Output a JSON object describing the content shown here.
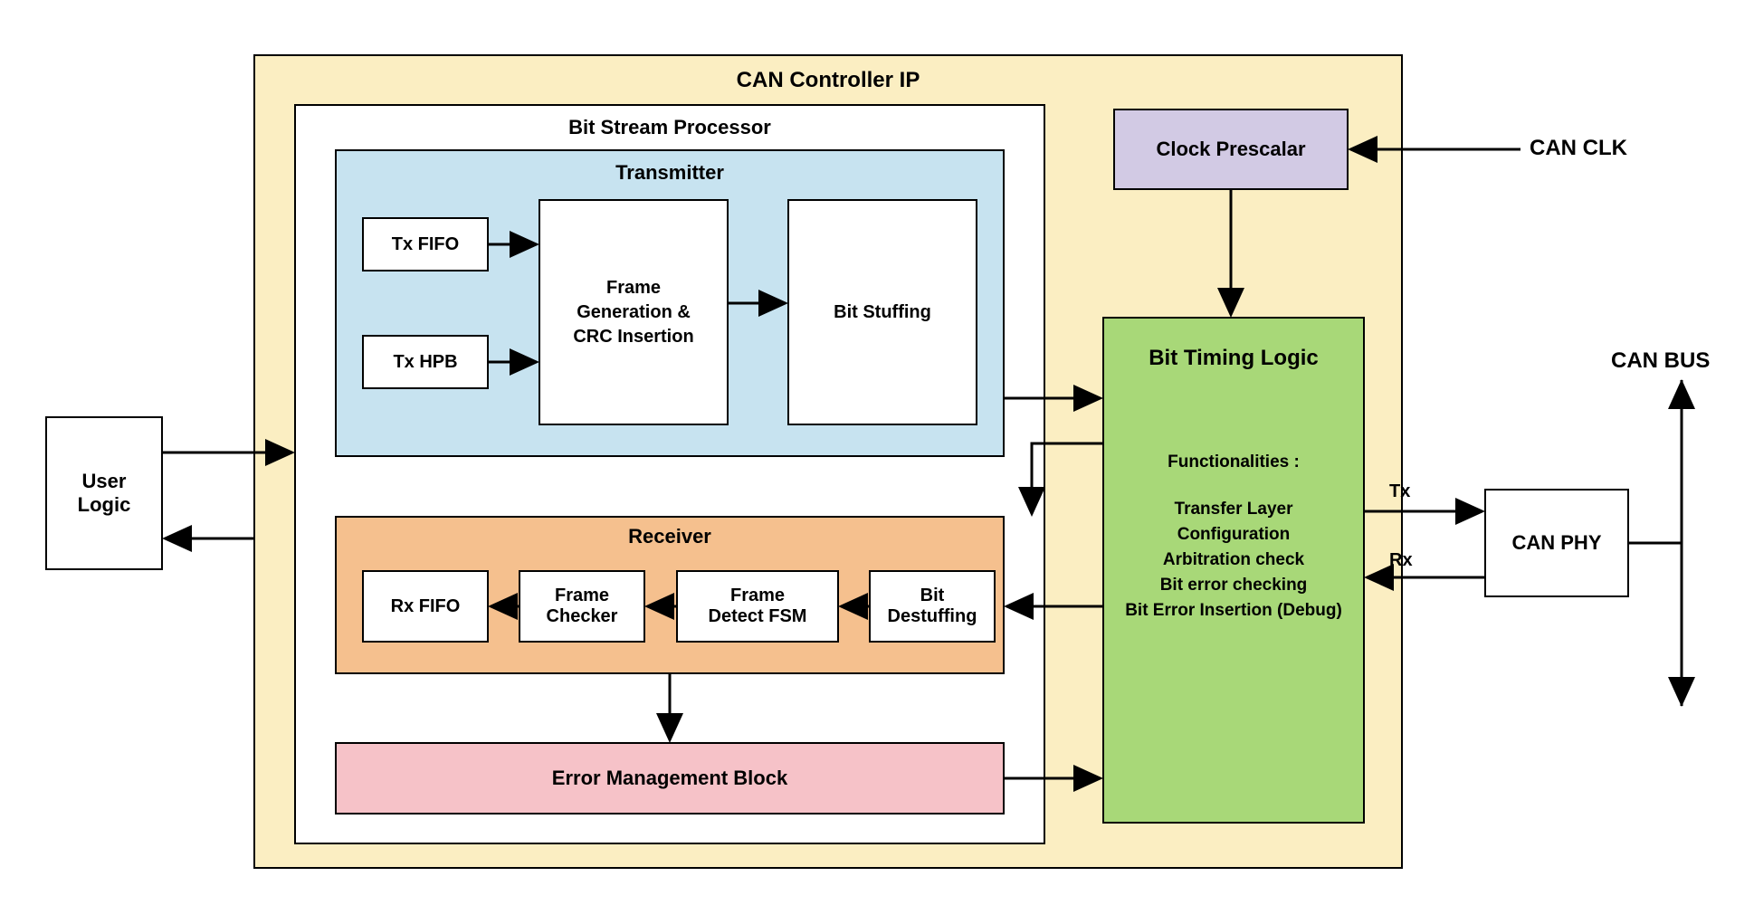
{
  "title": "CAN Controller IP",
  "external": {
    "user_logic": "User\nLogic",
    "can_phy": "CAN PHY",
    "can_clk": "CAN CLK",
    "can_bus": "CAN BUS",
    "tx": "Tx",
    "rx": "Rx"
  },
  "bsp": {
    "title": "Bit Stream Processor",
    "transmitter": {
      "title": "Transmitter",
      "tx_fifo": "Tx FIFO",
      "tx_hpb": "Tx HPB",
      "frame_gen": "Frame\nGeneration &\nCRC Insertion",
      "bit_stuffing": "Bit Stuffing"
    },
    "receiver": {
      "title": "Receiver",
      "rx_fifo": "Rx FIFO",
      "frame_checker": "Frame\nChecker",
      "frame_detect": "Frame\nDetect FSM",
      "bit_destuffing": "Bit\nDestuffing"
    },
    "emb": "Error Management Block"
  },
  "clock_prescalar": "Clock Prescalar",
  "btl": {
    "title": "Bit Timing Logic",
    "func_header": "Functionalities :",
    "f1": "Transfer Layer",
    "f2": "Configuration",
    "f3": "Arbitration check",
    "f4": "Bit error checking",
    "f5": "Bit Error Insertion (Debug)"
  }
}
